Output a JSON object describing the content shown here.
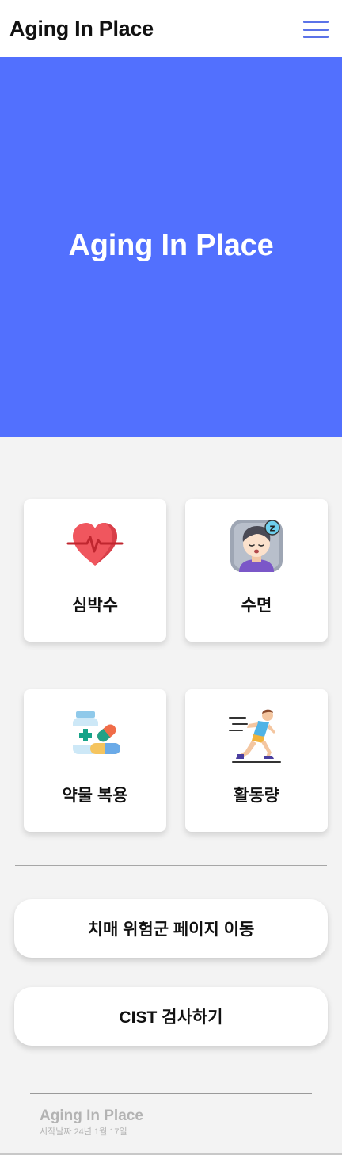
{
  "header": {
    "title": "Aging In Place",
    "menu_icon": "hamburger-menu-icon",
    "menu_color": "#5b73e8"
  },
  "hero": {
    "title": "Aging In Place",
    "background": "#5270fe"
  },
  "cards": [
    {
      "label": "심박수",
      "icon": "heartbeat-icon"
    },
    {
      "label": "수면",
      "icon": "sleeping-face-icon"
    },
    {
      "label": "약물 복용",
      "icon": "medicine-icon"
    },
    {
      "label": "활동량",
      "icon": "running-person-icon"
    }
  ],
  "actions": {
    "dementia_risk": "치매 위험군 페이지 이동",
    "cist_test": "CIST 검사하기"
  },
  "footer": {
    "title": "Aging In Place",
    "start_date": "시작날짜 24년 1월 17일"
  }
}
